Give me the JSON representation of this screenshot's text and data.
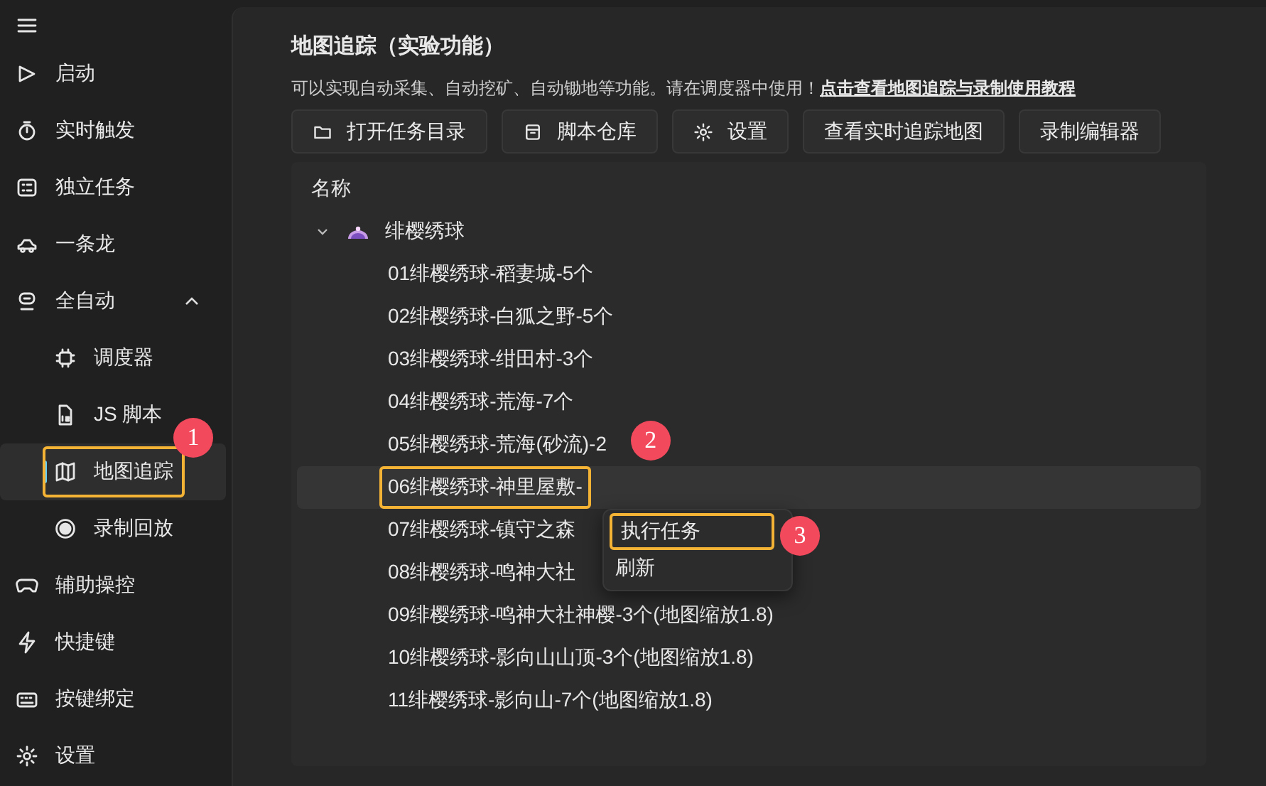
{
  "sidebar": {
    "items": [
      {
        "label": "启动",
        "selected": false
      },
      {
        "label": "实时触发",
        "selected": false
      },
      {
        "label": "独立任务",
        "selected": false
      },
      {
        "label": "一条龙",
        "selected": false
      },
      {
        "label": "全自动",
        "selected": false,
        "expanded": true,
        "children": [
          {
            "label": "调度器",
            "selected": false
          },
          {
            "label": "JS 脚本",
            "selected": false
          },
          {
            "label": "地图追踪",
            "selected": true,
            "callout": "1"
          },
          {
            "label": "录制回放",
            "selected": false
          }
        ]
      },
      {
        "label": "辅助操控",
        "selected": false
      },
      {
        "label": "快捷键",
        "selected": false
      },
      {
        "label": "按键绑定",
        "selected": false
      },
      {
        "label": "设置",
        "selected": false
      }
    ]
  },
  "page": {
    "title": "地图追踪（实验功能）",
    "description": "可以实现自动采集、自动挖矿、自动锄地等功能。请在调度器中使用！",
    "link": "点击查看地图追踪与录制使用教程"
  },
  "toolbar": [
    {
      "label": "打开任务目录",
      "kind": "folder"
    },
    {
      "label": "脚本仓库",
      "kind": "box"
    },
    {
      "label": "设置",
      "kind": "gear"
    },
    {
      "label": "查看实时追踪地图",
      "kind": "plain"
    },
    {
      "label": "录制编辑器",
      "kind": "plain"
    }
  ],
  "tree": {
    "column": "名称",
    "groups": [
      {
        "label": "绯樱绣球",
        "expanded": true,
        "children": [
          {
            "label": "01绯樱绣球-稻妻城-5个",
            "selected": false
          },
          {
            "label": "02绯樱绣球-白狐之野-5个",
            "selected": false
          },
          {
            "label": "03绯樱绣球-绀田村-3个",
            "selected": false
          },
          {
            "label": "04绯樱绣球-荒海-7个",
            "selected": false
          },
          {
            "label": "05绯樱绣球-荒海(砂流)-2",
            "selected": false
          },
          {
            "label": "06绯樱绣球-神里屋敷-",
            "selected": true,
            "callout": "2",
            "menu": [
              {
                "label": "执行任务",
                "callout": "3"
              },
              {
                "label": "刷新"
              }
            ]
          },
          {
            "label": "07绯樱绣球-镇守之森",
            "selected": false
          },
          {
            "label": "08绯樱绣球-鸣神大社",
            "selected": false
          },
          {
            "label": "09绯樱绣球-鸣神大社神樱-3个(地图缩放1.8)",
            "selected": false
          },
          {
            "label": "10绯樱绣球-影向山山顶-3个(地图缩放1.8)",
            "selected": false
          },
          {
            "label": "11绯樱绣球-影向山-7个(地图缩放1.8)",
            "selected": false
          }
        ]
      }
    ]
  }
}
